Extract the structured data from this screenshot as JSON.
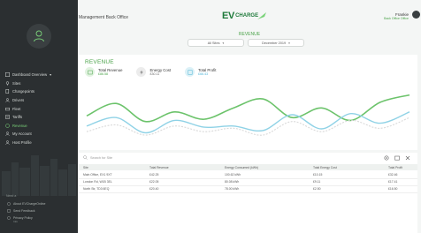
{
  "header": {
    "section": "Management Back Office",
    "logo_ev": "EV",
    "logo_charge": "CHARGE",
    "user_name": "Frankie",
    "user_role": "Back Office Office"
  },
  "sidebar": {
    "items": [
      {
        "label": "Dashboard Overview",
        "icon": "dashboard-icon"
      },
      {
        "label": "Sites",
        "icon": "pin-icon"
      },
      {
        "label": "Chargepoints",
        "icon": "charger-icon"
      },
      {
        "label": "Drivers",
        "icon": "drivers-icon"
      },
      {
        "label": "Fleet",
        "icon": "fleet-icon"
      },
      {
        "label": "Tariffs",
        "icon": "tariff-icon"
      },
      {
        "label": "Revenue",
        "icon": "revenue-icon"
      },
      {
        "label": "My Account",
        "icon": "account-icon"
      },
      {
        "label": "Host Profile",
        "icon": "profile-icon"
      }
    ],
    "footer_title": "Need a",
    "footer_items": [
      {
        "label": "About EVChargeOnline",
        "icon": "info-icon"
      },
      {
        "label": "Send Feedback",
        "icon": "feedback-icon"
      },
      {
        "label": "Privacy Policy",
        "icon": "policy-icon"
      }
    ],
    "footer_sub": "Info"
  },
  "page": {
    "title": "REVENUE",
    "site_select": "All Sites",
    "month_select": "December 2019"
  },
  "revenue_card": {
    "title": "REVENUE",
    "stats": [
      {
        "label": "Total Revenue",
        "value": "£86.58"
      },
      {
        "label": "Energy Cost",
        "value": "£30.11"
      },
      {
        "label": "Total Profit",
        "value": "£66.43"
      }
    ]
  },
  "colors": {
    "accent": "#4ba34a",
    "sidebar": "#2b2f31",
    "line_green": "#6cc36b",
    "line_blue": "#8fd2e6",
    "line_grey": "#d9d9d9"
  },
  "chart_data": {
    "type": "line",
    "series": [
      {
        "values": [
          0.48,
          0.7,
          0.38,
          0.55,
          0.42,
          0.62,
          0.78,
          0.45,
          0.62,
          0.4,
          0.72,
          0.85
        ]
      },
      {
        "values": [
          0.3,
          0.45,
          0.18,
          0.4,
          0.28,
          0.3,
          0.22,
          0.5,
          0.25,
          0.52,
          0.35,
          0.55
        ]
      },
      {
        "values": [
          0.2,
          0.32,
          0.14,
          0.3,
          0.2,
          0.26,
          0.14,
          0.38,
          0.2,
          0.4,
          0.26,
          0.45
        ]
      }
    ],
    "ylim": [
      0,
      1
    ],
    "grid": false
  },
  "table": {
    "search_placeholder": "Search for Site",
    "columns": [
      "Site",
      "Total Revenue",
      "Energy Consumed (kWh)",
      "Total Energy Cost",
      "Total Profit"
    ],
    "rows": [
      [
        "Main Office, EX1 9XT",
        "£42.25",
        "100.62 kWh",
        "£10.15",
        "£32.46"
      ],
      [
        "London Rd, W1B 3EL",
        "£22.05",
        "80.08 kWh",
        "£9.11",
        "£17.41"
      ],
      [
        "North Str, TD3 6EQ",
        "£20.40",
        "78.00 kWh",
        "£2.50",
        "£16.50"
      ]
    ]
  }
}
